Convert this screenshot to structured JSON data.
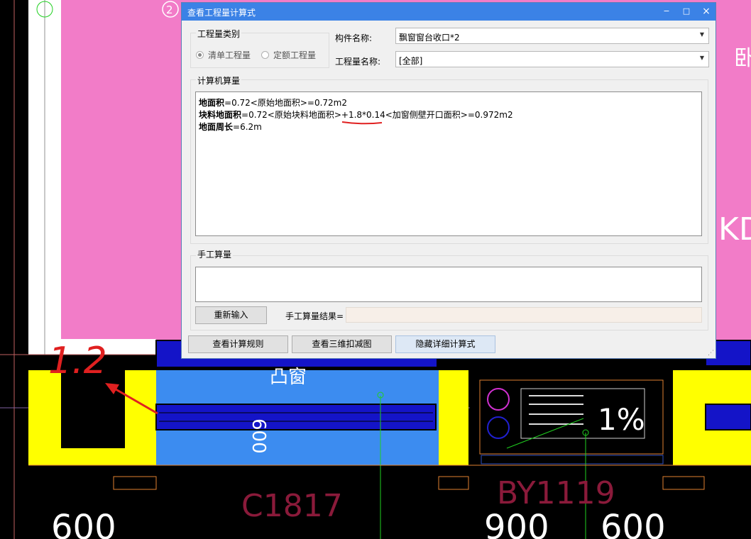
{
  "background_drawing": {
    "labels": {
      "window": "C1817",
      "bay_window": "BY1119",
      "dim_left": "600",
      "dim_mid": "900",
      "dim_right": "600",
      "slope": "1%",
      "marker": "2",
      "edge_left": "卧",
      "edge_right": "KD",
      "handwritten": "1.2",
      "vertical_text": "凸窗",
      "number_600": "600"
    },
    "colors": {
      "pink": "#f27cc8",
      "yellow": "#ffff00",
      "blue": "#3c8cf0",
      "dark_blue": "#1414c8",
      "red": "#e02020"
    }
  },
  "dialog": {
    "title": "查看工程量计算式",
    "controls": {
      "minimize": "−",
      "maximize": "□",
      "close": "×"
    },
    "quantity_type": {
      "label": "工程量类别",
      "options": [
        {
          "label": "清单工程量",
          "selected": true
        },
        {
          "label": "定额工程量",
          "selected": false
        }
      ]
    },
    "component_name": {
      "label": "构件名称:",
      "value": "飘窗窗台收口*2"
    },
    "quantity_name": {
      "label": "工程量名称:",
      "value": "[全部]"
    },
    "computed": {
      "label": "计算机算量",
      "lines": [
        {
          "bold": "地面积",
          "text": "=0.72<原始地面积>=0.72m2"
        },
        {
          "bold": "块料地面积",
          "text": "=0.72<原始块料地面积>+1.8*0.14<加窗侧壁开口面积>=0.972m2"
        },
        {
          "bold": "地面周长",
          "text": "=6.2m"
        }
      ]
    },
    "manual": {
      "label": "手工算量",
      "reinput_button": "重新输入",
      "result_label": "手工算量结果=",
      "result_value": ""
    },
    "buttons": {
      "rules": "查看计算规则",
      "view_3d": "查看三维扣减图",
      "hide_detail": "隐藏详细计算式"
    }
  }
}
